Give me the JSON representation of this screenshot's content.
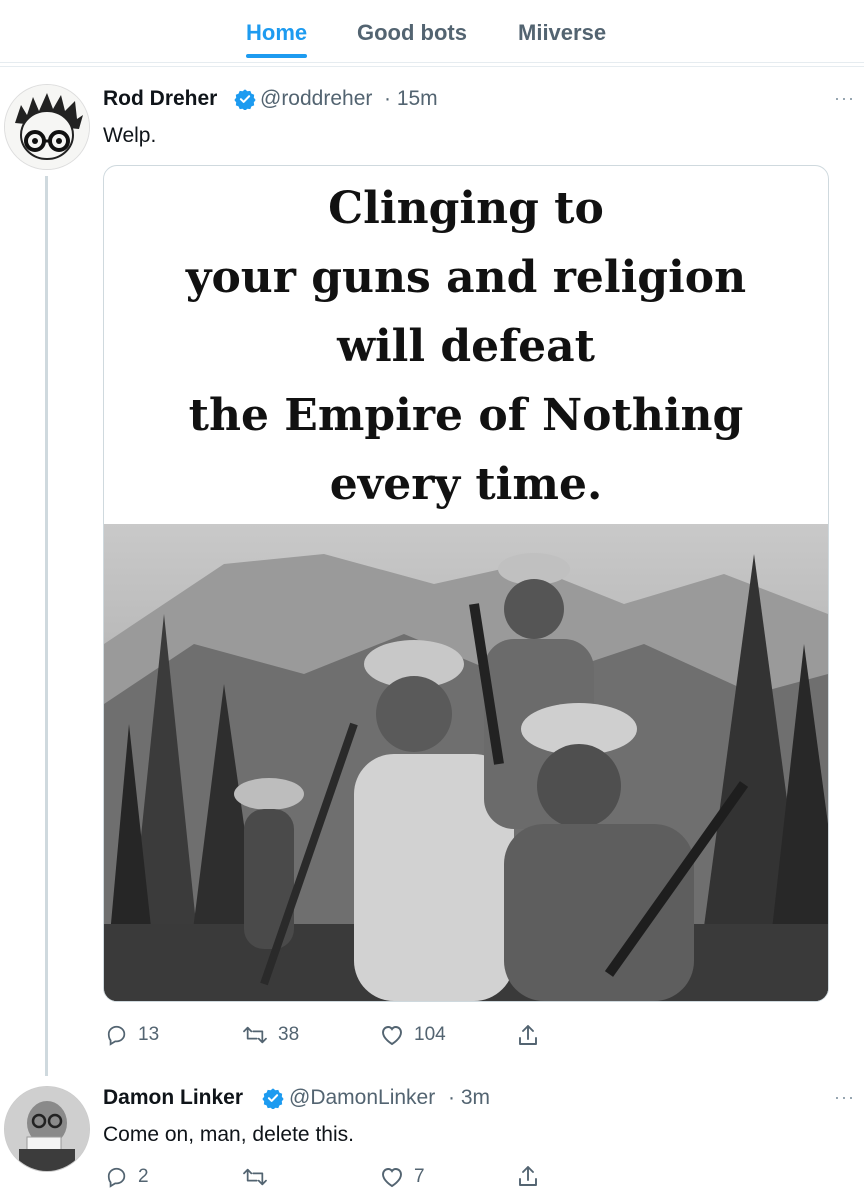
{
  "tabs": [
    {
      "label": "Home",
      "active": true
    },
    {
      "label": "Good bots",
      "active": false
    },
    {
      "label": "Miiverse",
      "active": false
    }
  ],
  "tweets": [
    {
      "name": "Rod Dreher",
      "handle": "@roddreher",
      "time": "· 15m",
      "text": "Welp.",
      "verified": true,
      "media_text": [
        "Clinging to",
        "your guns and religion",
        "will defeat",
        "the Empire of Nothing",
        "every time."
      ],
      "replies": "13",
      "retweets": "38",
      "likes": "104"
    },
    {
      "name": "Damon Linker",
      "handle": "@DamonLinker",
      "time": "· 3m",
      "text": "Come on, man, delete this.",
      "verified": true,
      "replies": "2",
      "retweets": "",
      "likes": "7"
    }
  ],
  "icons": {
    "more": "more-icon",
    "reply": "reply-icon",
    "retweet": "retweet-icon",
    "like": "heart-icon",
    "share": "share-icon",
    "verified": "verified-badge-icon"
  },
  "colors": {
    "accent": "#1d9bf0",
    "muted": "#536471",
    "border": "#e6ecf0"
  }
}
